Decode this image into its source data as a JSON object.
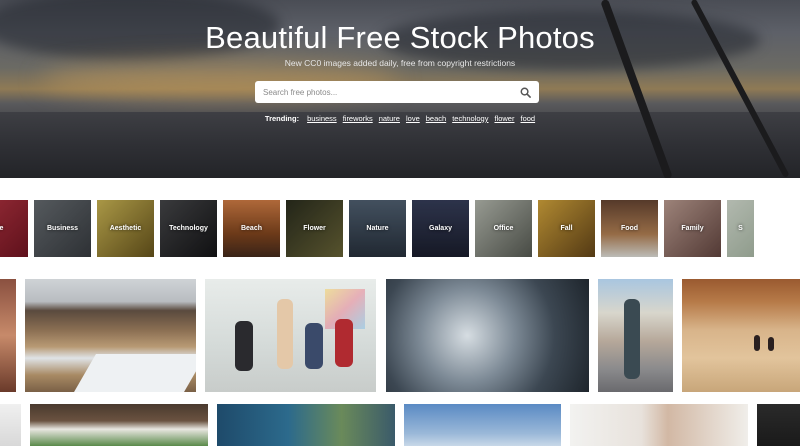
{
  "hero": {
    "title": "Beautiful Free Stock Photos",
    "subtitle": "New CC0 images added daily, free from copyright restrictions",
    "search_placeholder": "Search free photos...",
    "trending_label": "Trending:",
    "trending": [
      "business",
      "fireworks",
      "nature",
      "love",
      "beach",
      "technology",
      "flower",
      "food"
    ]
  },
  "categories": [
    {
      "label": "ve",
      "color": "#9c2534"
    },
    {
      "label": "Business",
      "color": "#52575c"
    },
    {
      "label": "Aesthetic",
      "color": "#b39a3a"
    },
    {
      "label": "Technology",
      "color": "#2a2b2d"
    },
    {
      "label": "Beach",
      "color": "#b0622a"
    },
    {
      "label": "Flower",
      "color": "#4a4d30"
    },
    {
      "label": "Nature",
      "color": "#3b4855"
    },
    {
      "label": "Galaxy",
      "color": "#2e3347"
    },
    {
      "label": "Office",
      "color": "#8f9486"
    },
    {
      "label": "Fall",
      "color": "#b98a2c"
    },
    {
      "label": "Food",
      "color": "#8a5a3e"
    },
    {
      "label": "Family",
      "color": "#a27c72"
    },
    {
      "label": "S",
      "color": "#c9d6c8"
    }
  ],
  "colors": {
    "hero_dark": "#2b2c31",
    "accent_sunset": "#cda05a",
    "text_white": "#ffffff"
  }
}
